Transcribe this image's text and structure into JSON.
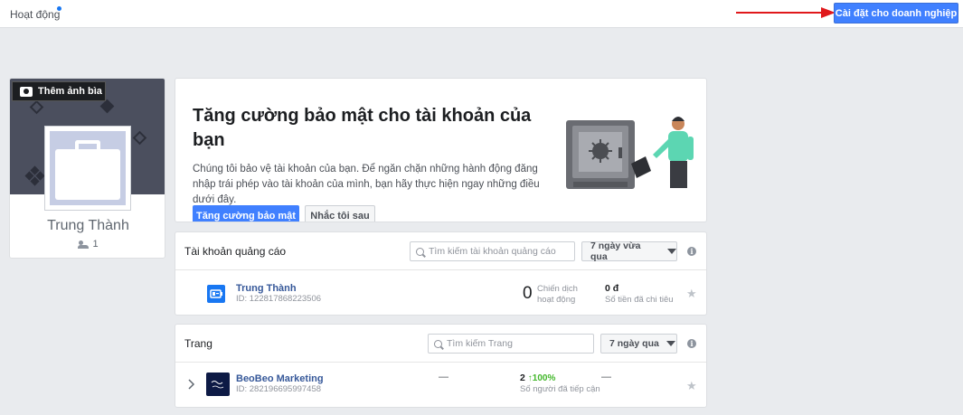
{
  "topbar": {
    "activity_label": "Hoạt động",
    "business_settings_label": "Cài đặt cho doanh nghiệp"
  },
  "profile": {
    "add_cover_label": "Thêm ảnh bìa",
    "name": "Trung Thành",
    "member_count": "1"
  },
  "security": {
    "title": "Tăng cường bảo mật cho tài khoản của bạn",
    "description": "Chúng tôi bảo vệ tài khoản của bạn. Để ngăn chặn những hành động đăng nhập trái phép vào tài khoản của mình, bạn hãy thực hiện ngay những điều dưới đây.",
    "primary_button": "Tăng cường bảo mật",
    "secondary_button": "Nhắc tôi sau"
  },
  "ad_accounts": {
    "title": "Tài khoản quảng cáo",
    "search_placeholder": "Tìm kiếm tài khoản quảng cáo",
    "range": "7 ngày vừa qua",
    "row": {
      "name": "Trung Thành",
      "id": "ID: 122817868223506",
      "active_campaigns": "0",
      "active_campaigns_label_1": "Chiến dịch",
      "active_campaigns_label_2": "hoạt động",
      "spend": "0 đ",
      "spend_label": "Số tiền đã chi tiêu"
    }
  },
  "pages": {
    "title": "Trang",
    "search_placeholder": "Tìm kiếm Trang",
    "range": "7 ngày qua",
    "row": {
      "name": "BeoBeo Marketing",
      "id": "ID: 282196695997458",
      "dash_1": "—",
      "reach": "2",
      "reach_change": "↑100%",
      "reach_label": "Số người đã tiếp cận",
      "dash_2": "—"
    }
  },
  "colors": {
    "accent": "#4080ff",
    "link": "#365899",
    "annotation_arrow": "#e0181b"
  }
}
